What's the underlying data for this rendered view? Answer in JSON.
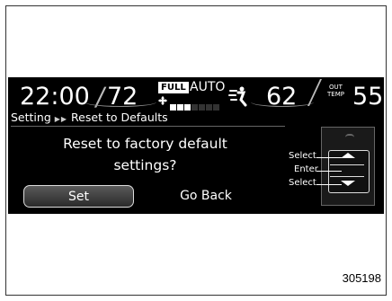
{
  "status_bar": {
    "time": "22:00",
    "left_temp": "72",
    "fan_mode_badge": "FULL",
    "fan_mode": "AUTO",
    "fan_level_bars": [
      1,
      1,
      1,
      0,
      0,
      0,
      0
    ],
    "right_temp": "62",
    "outside_label_line1": "OUT",
    "outside_label_line2": "TEMP",
    "outside_temp": "55°F"
  },
  "breadcrumb": {
    "parent": "Setting",
    "separator": "▶▶",
    "current": "Reset to Defaults"
  },
  "dialog": {
    "prompt_line1": "Reset to factory default",
    "prompt_line2": "settings?",
    "set_label": "Set",
    "back_label": "Go Back"
  },
  "callouts": {
    "select_up": "Select",
    "enter": "Enter",
    "select_down": "Select"
  },
  "figure_number": "305198"
}
